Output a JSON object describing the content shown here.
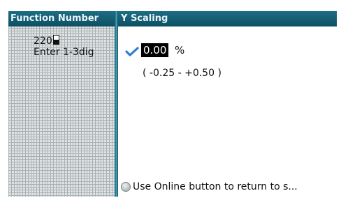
{
  "left_panel": {
    "header": "Function Number",
    "value": "220",
    "hint": "Enter 1-3dig"
  },
  "right_panel": {
    "header": "Y Scaling",
    "value": "0.00",
    "unit": "%",
    "range": "( -0.25 - +0.50 )",
    "footer": "Use Online button to return to s..."
  },
  "icons": {
    "check": "checkmark-icon",
    "footer": "online-button-icon"
  },
  "colors": {
    "header_bg": "#0e4f63",
    "check": "#2a7fd4"
  }
}
